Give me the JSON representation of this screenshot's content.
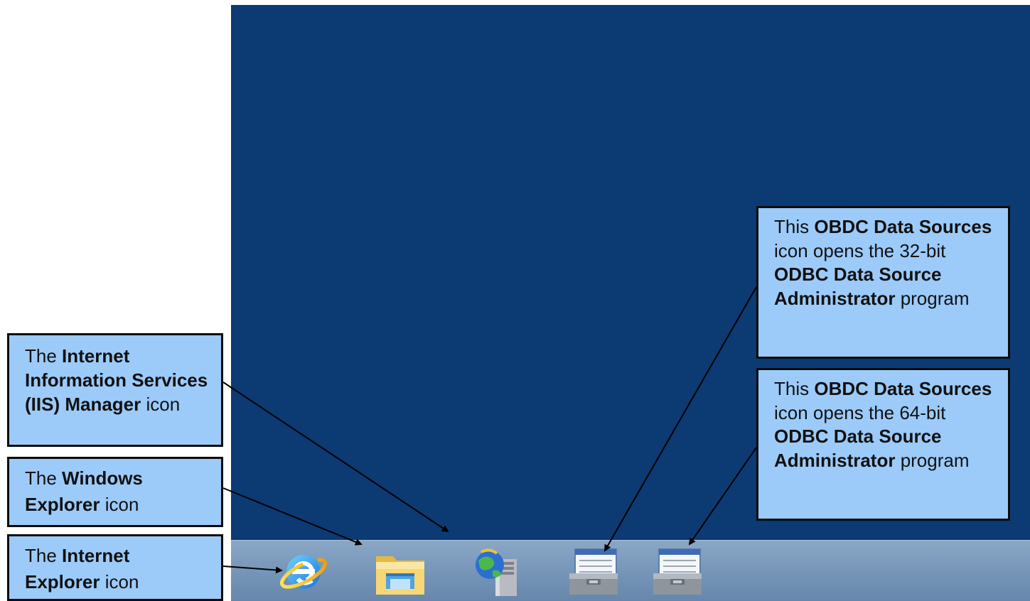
{
  "callouts": {
    "iis": {
      "pre": "The ",
      "bold1": "Internet Information Services (IIS) Manager",
      "post": " icon"
    },
    "explorer": {
      "pre": "The ",
      "bold1": "Windows Explorer",
      "post": " icon"
    },
    "ie": {
      "pre": "The ",
      "bold1": "Internet Explorer",
      "post": " icon"
    },
    "odbc32": {
      "t1": "This ",
      "b1": "OBDC Data Sources",
      "t2": " icon opens the 32-bit ",
      "b2": "ODBC Data Source Administrator",
      "t3": " program"
    },
    "odbc64": {
      "t1": "This ",
      "b1": "OBDC Data Sources",
      "t2": " icon opens the 64-bit ",
      "b2": "ODBC Data Source Administrator",
      "t3": " program"
    }
  },
  "taskbar": {
    "icons": [
      "internet-explorer-icon",
      "file-explorer-icon",
      "iis-manager-icon",
      "odbc-32-icon",
      "odbc-64-icon"
    ]
  },
  "colors": {
    "desktop": "#0c3a73",
    "callout_fill": "#9ccbfa",
    "callout_border": "#0a0a0a",
    "taskbar": "#7a9abd"
  }
}
